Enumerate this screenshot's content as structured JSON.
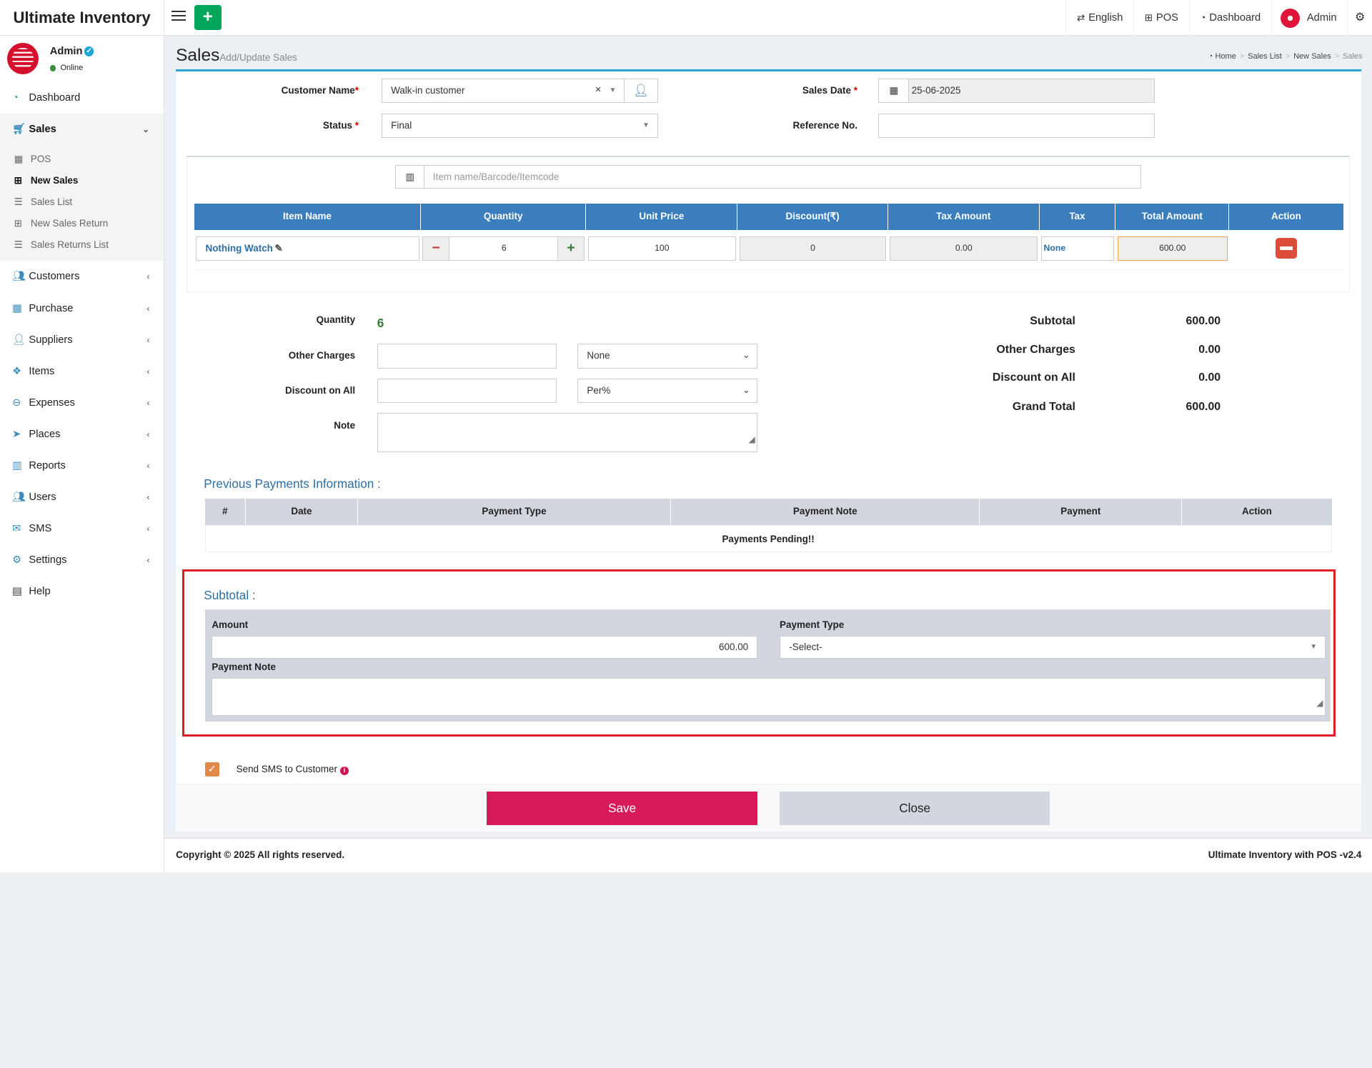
{
  "app": {
    "title": "Ultimate Inventory"
  },
  "topnav": {
    "language": "English",
    "pos": "POS",
    "dashboard": "Dashboard",
    "admin": "Admin"
  },
  "user": {
    "name": "Admin",
    "status": "Online"
  },
  "sidebar": {
    "items": [
      {
        "label": "Dashboard",
        "icon": "dashboard-icon"
      },
      {
        "label": "Sales",
        "icon": "cart-icon"
      },
      {
        "label": "Customers",
        "icon": "users-icon"
      },
      {
        "label": "Purchase",
        "icon": "grid-icon"
      },
      {
        "label": "Suppliers",
        "icon": "user-plus-icon"
      },
      {
        "label": "Items",
        "icon": "cubes-icon"
      },
      {
        "label": "Expenses",
        "icon": "minus-circle-icon"
      },
      {
        "label": "Places",
        "icon": "paper-plane-icon"
      },
      {
        "label": "Reports",
        "icon": "bar-chart-icon"
      },
      {
        "label": "Users",
        "icon": "users-icon"
      },
      {
        "label": "SMS",
        "icon": "envelope-icon"
      },
      {
        "label": "Settings",
        "icon": "cogs-icon"
      },
      {
        "label": "Help",
        "icon": "book-icon"
      }
    ],
    "sales_sub": [
      {
        "label": "POS",
        "icon": "calculator-icon"
      },
      {
        "label": "New Sales",
        "icon": "plus-square-icon"
      },
      {
        "label": "Sales List",
        "icon": "list-icon"
      },
      {
        "label": "New Sales Return",
        "icon": "plus-square-icon"
      },
      {
        "label": "Sales Returns List",
        "icon": "list-icon"
      }
    ]
  },
  "page": {
    "title": "Sales",
    "subtitle": "Add/Update Sales"
  },
  "breadcrumb": {
    "home": "Home",
    "sales_list": "Sales List",
    "new_sales": "New Sales",
    "current": "Sales"
  },
  "form": {
    "customer_label": "Customer Name",
    "customer_value": "Walk-in customer",
    "sales_date_label": "Sales Date",
    "sales_date_value": "25-06-2025",
    "status_label": "Status",
    "status_value": "Final",
    "reference_label": "Reference No.",
    "reference_value": "",
    "item_search_placeholder": "Item name/Barcode/Itemcode"
  },
  "items_table": {
    "headers": [
      "Item Name",
      "Quantity",
      "Unit Price",
      "Discount(₹)",
      "Tax Amount",
      "Tax",
      "Total Amount",
      "Action"
    ],
    "rows": [
      {
        "item": "Nothing Watch",
        "qty": "6",
        "unit_price": "100",
        "discount": "0",
        "tax_amount": "0.00",
        "tax": "None",
        "total": "600.00"
      }
    ]
  },
  "totals_form": {
    "quantity_label": "Quantity",
    "quantity_value": "6",
    "other_charges_label": "Other Charges",
    "other_charges_tax": "None",
    "discount_label": "Discount on All",
    "discount_type": "Per%",
    "note_label": "Note"
  },
  "summary": {
    "subtotal_label": "Subtotal",
    "subtotal": "600.00",
    "other_charges_label": "Other Charges",
    "other_charges": "0.00",
    "discount_label": "Discount on All",
    "discount": "0.00",
    "grand_total_label": "Grand Total",
    "grand_total": "600.00"
  },
  "previous_payments": {
    "title": "Previous Payments Information :",
    "headers": [
      "#",
      "Date",
      "Payment Type",
      "Payment Note",
      "Payment",
      "Action"
    ],
    "empty": "Payments Pending!!"
  },
  "payment": {
    "title": "Subtotal :",
    "amount_label": "Amount",
    "amount_value": "600.00",
    "type_label": "Payment Type",
    "type_value": "-Select-",
    "note_label": "Payment Note"
  },
  "sms": {
    "label": "Send SMS to Customer",
    "checked": true
  },
  "buttons": {
    "save": "Save",
    "close": "Close"
  },
  "footer": {
    "copyright": "Copyright © 2025 All rights reserved.",
    "version": "Ultimate Inventory with POS -v2.4"
  },
  "colors": {
    "accent": "#3a7ebd",
    "save": "#d8195a",
    "add": "#00a65a",
    "highlight": "#dd1e2a"
  }
}
